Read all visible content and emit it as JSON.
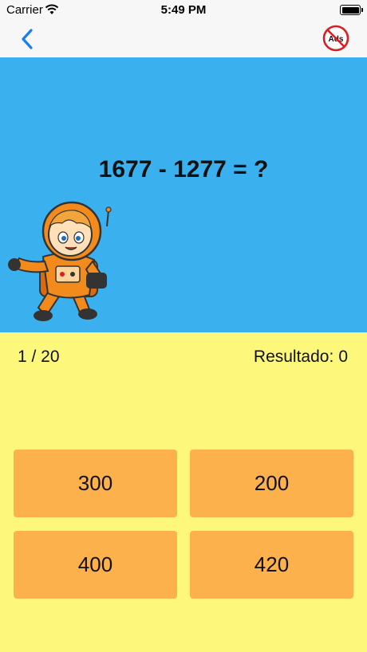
{
  "status_bar": {
    "carrier": "Carrier",
    "time": "5:49 PM"
  },
  "nav": {
    "back_icon": "chevron-left-icon",
    "ads_icon": "no-ads-icon",
    "ads_label": "Ads",
    "accent": "#1a7ef0"
  },
  "question": {
    "text": "1677 - 1277 = ?",
    "panel_color": "#3ab1ee"
  },
  "progress": {
    "text": "1 / 20"
  },
  "score": {
    "label": "Resultado:",
    "value": "0"
  },
  "answers": [
    {
      "label": "300"
    },
    {
      "label": "200"
    },
    {
      "label": "400"
    },
    {
      "label": "420"
    }
  ],
  "colors": {
    "background": "#fdf87b",
    "button": "#fdb14c"
  }
}
